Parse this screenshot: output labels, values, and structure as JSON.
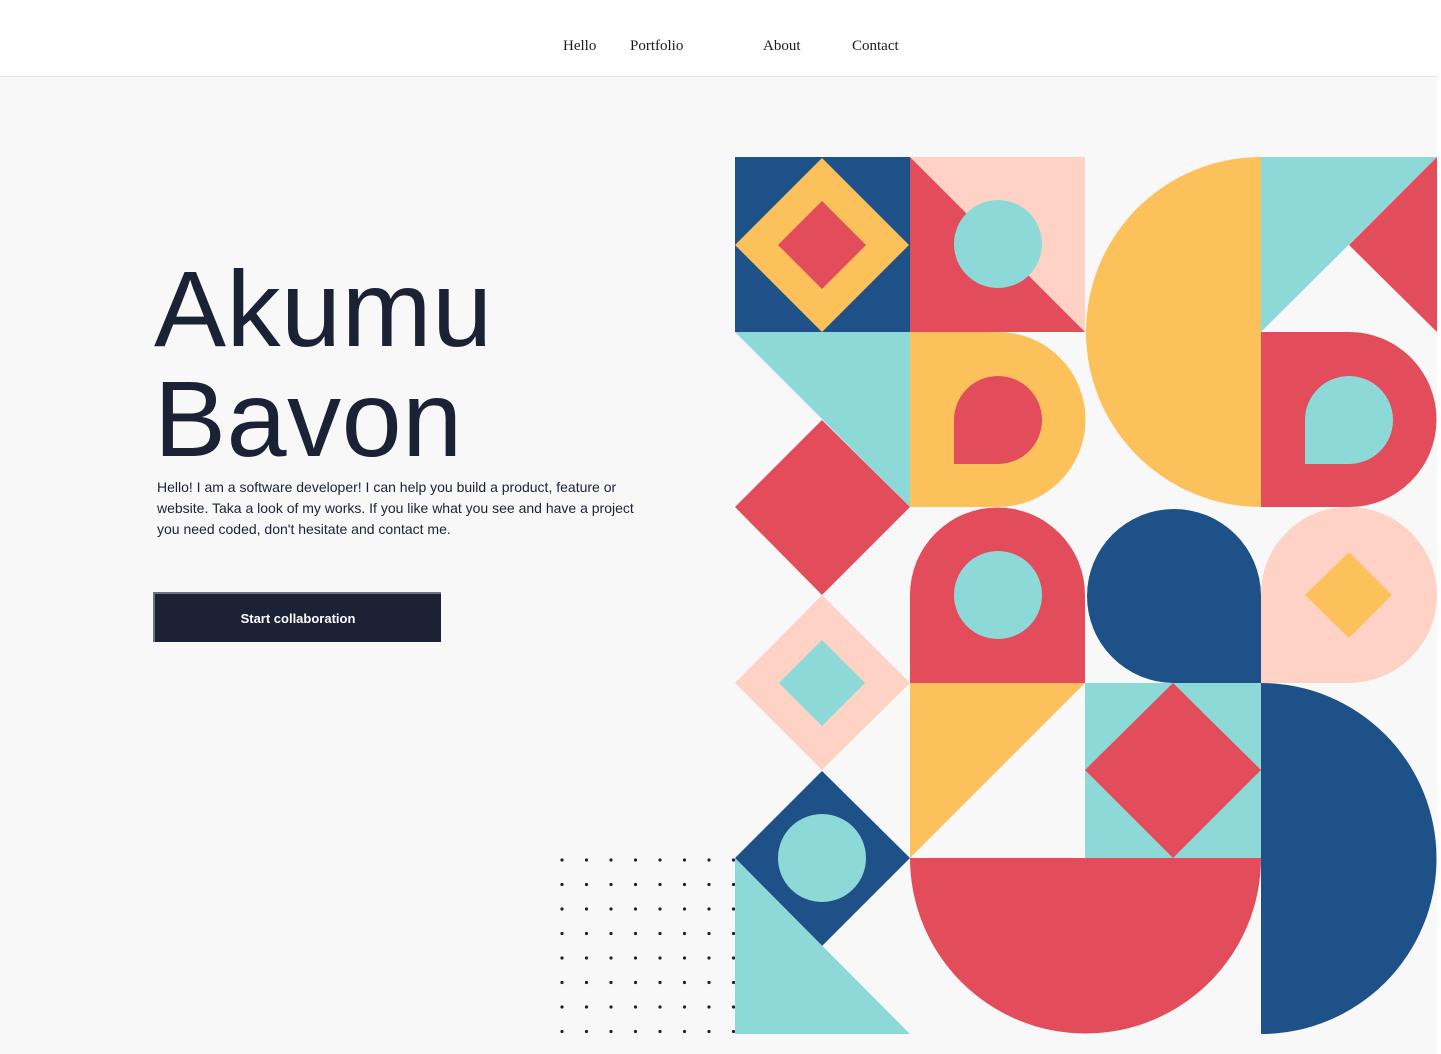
{
  "nav": {
    "items": [
      {
        "label": "Hello"
      },
      {
        "label": "Portfolio"
      },
      {
        "label": "About"
      },
      {
        "label": "Contact"
      }
    ]
  },
  "hero": {
    "title_line1": "Akumu",
    "title_line2": "Bavon",
    "description": "Hello! I am a software developer! I can help you build a product, feature or website. Taka a look of my works. If you like what you see and have a project you need coded, don't hesitate and contact me.",
    "cta_label": "Start collaboration"
  },
  "colors": {
    "navy": "#1d5187",
    "yellow": "#fdc15b",
    "red": "#e24c5b",
    "teal": "#8cd9d8",
    "peach": "#fed3c5",
    "dark": "#1b2235",
    "background": "#f8f8f8"
  }
}
